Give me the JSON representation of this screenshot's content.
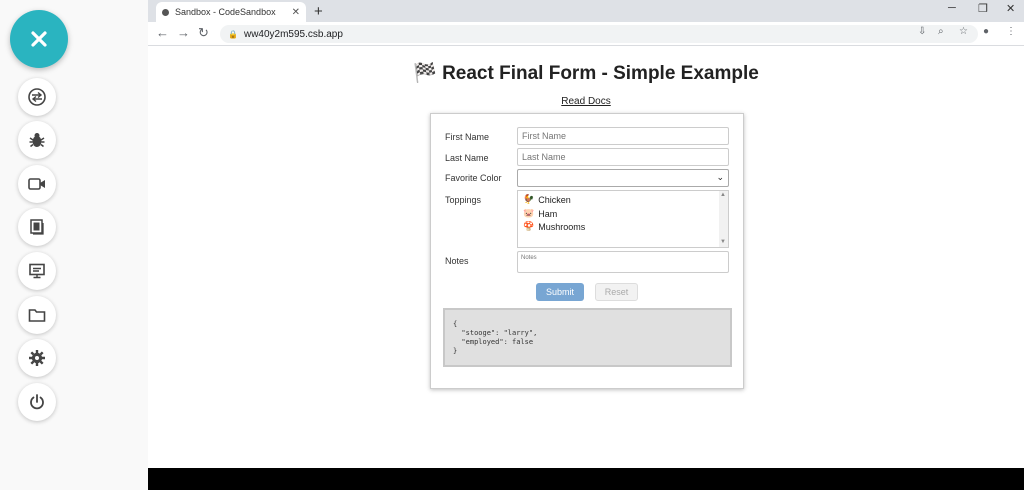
{
  "sidebar": {
    "close_icon": "close-icon",
    "tools": [
      {
        "name": "transfer-icon"
      },
      {
        "name": "bug-icon"
      },
      {
        "name": "video-icon"
      },
      {
        "name": "clipboard-icon"
      },
      {
        "name": "monitor-icon"
      },
      {
        "name": "folder-icon"
      },
      {
        "name": "gear-icon"
      },
      {
        "name": "power-icon"
      }
    ]
  },
  "browser": {
    "tab_title": "Sandbox - CodeSandbox",
    "tab_close": "✕",
    "new_tab": "+",
    "url": "ww40y2m595.csb.app"
  },
  "page": {
    "title": "🏁 React Final Form - Simple Example",
    "read_docs": "Read Docs"
  },
  "form": {
    "first_name_label": "First Name",
    "first_name_placeholder": "First Name",
    "last_name_label": "Last Name",
    "last_name_placeholder": "Last Name",
    "favorite_color_label": "Favorite Color",
    "toppings_label": "Toppings",
    "toppings": [
      {
        "emoji": "🐓",
        "label": "Chicken"
      },
      {
        "emoji": "🐷",
        "label": "Ham"
      },
      {
        "emoji": "🍄",
        "label": "Mushrooms"
      }
    ],
    "notes_label": "Notes",
    "notes_placeholder": "Notes",
    "submit_label": "Submit",
    "reset_label": "Reset"
  },
  "output": {
    "json_text": "{\n  \"stooge\": \"larry\",\n  \"employed\": false\n}"
  },
  "colors": {
    "accent": "#2ab4c0",
    "submit": "#78a6d3"
  }
}
